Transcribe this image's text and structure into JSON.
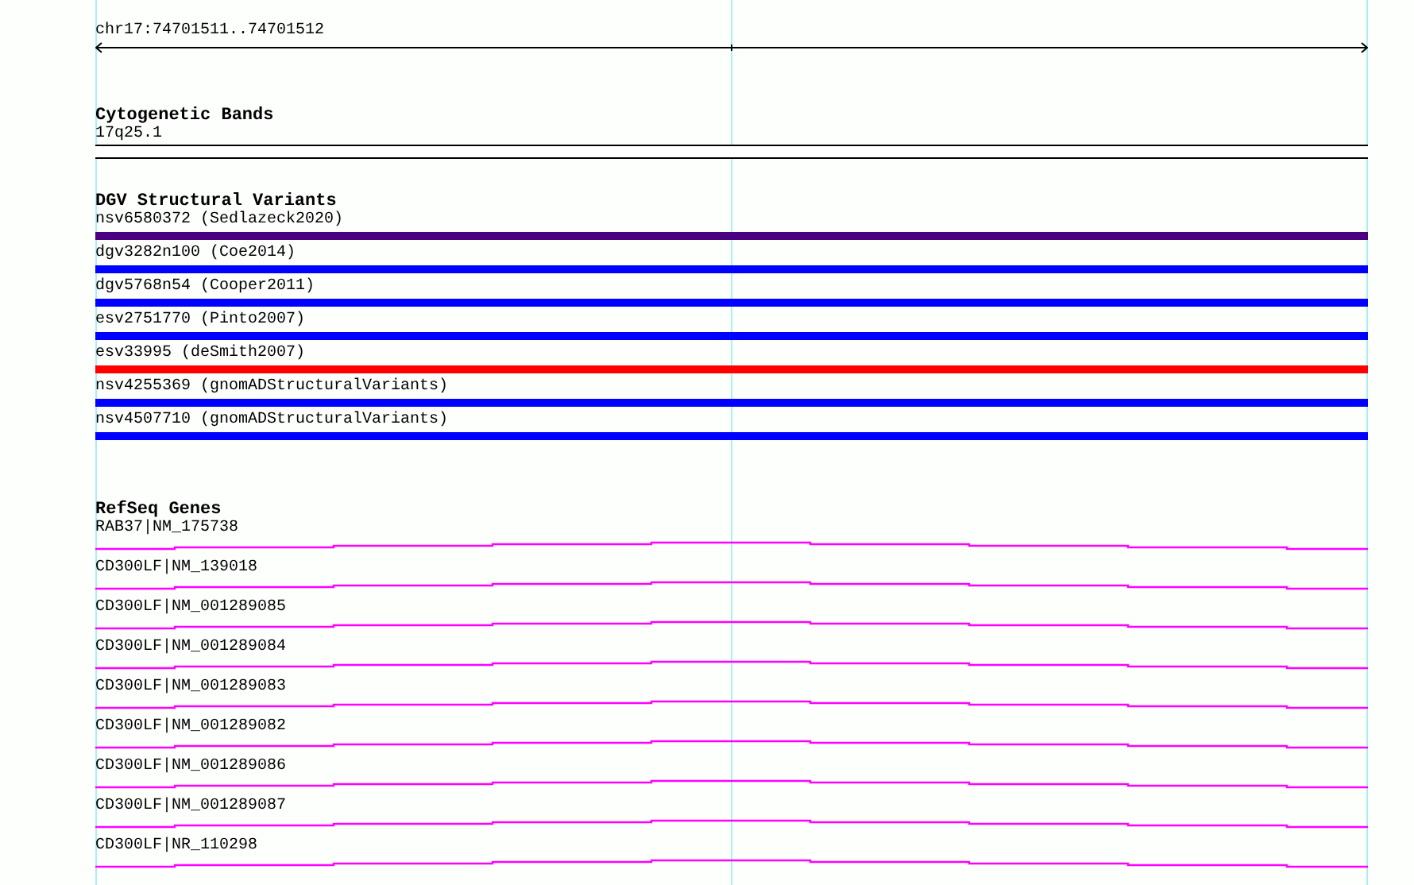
{
  "ruler": {
    "label": "chr17:74701511..74701512"
  },
  "cytogenetic_bands": {
    "title": "Cytogenetic Bands",
    "bands": [
      {
        "label": "17q25.1"
      }
    ]
  },
  "dgv_structural_variants": {
    "title": "DGV Structural Variants",
    "items": [
      {
        "label": "nsv6580372 (Sedlazeck2020)",
        "color": "#4b0082"
      },
      {
        "label": "dgv3282n100 (Coe2014)",
        "color": "#0000ff"
      },
      {
        "label": "dgv5768n54 (Cooper2011)",
        "color": "#0000ff"
      },
      {
        "label": "esv2751770 (Pinto2007)",
        "color": "#0000ff"
      },
      {
        "label": "esv33995 (deSmith2007)",
        "color": "#ff0000"
      },
      {
        "label": "nsv4255369 (gnomADStructuralVariants)",
        "color": "#0000ff"
      },
      {
        "label": "nsv4507710 (gnomADStructuralVariants)",
        "color": "#0000ff"
      }
    ]
  },
  "refseq_genes": {
    "title": "RefSeq Genes",
    "items": [
      {
        "label": "RAB37|NM_175738"
      },
      {
        "label": "CD300LF|NM_139018"
      },
      {
        "label": "CD300LF|NM_001289085"
      },
      {
        "label": "CD300LF|NM_001289084"
      },
      {
        "label": "CD300LF|NM_001289083"
      },
      {
        "label": "CD300LF|NM_001289082"
      },
      {
        "label": "CD300LF|NM_001289086"
      },
      {
        "label": "CD300LF|NM_001289087"
      },
      {
        "label": "CD300LF|NR_110298"
      }
    ]
  }
}
